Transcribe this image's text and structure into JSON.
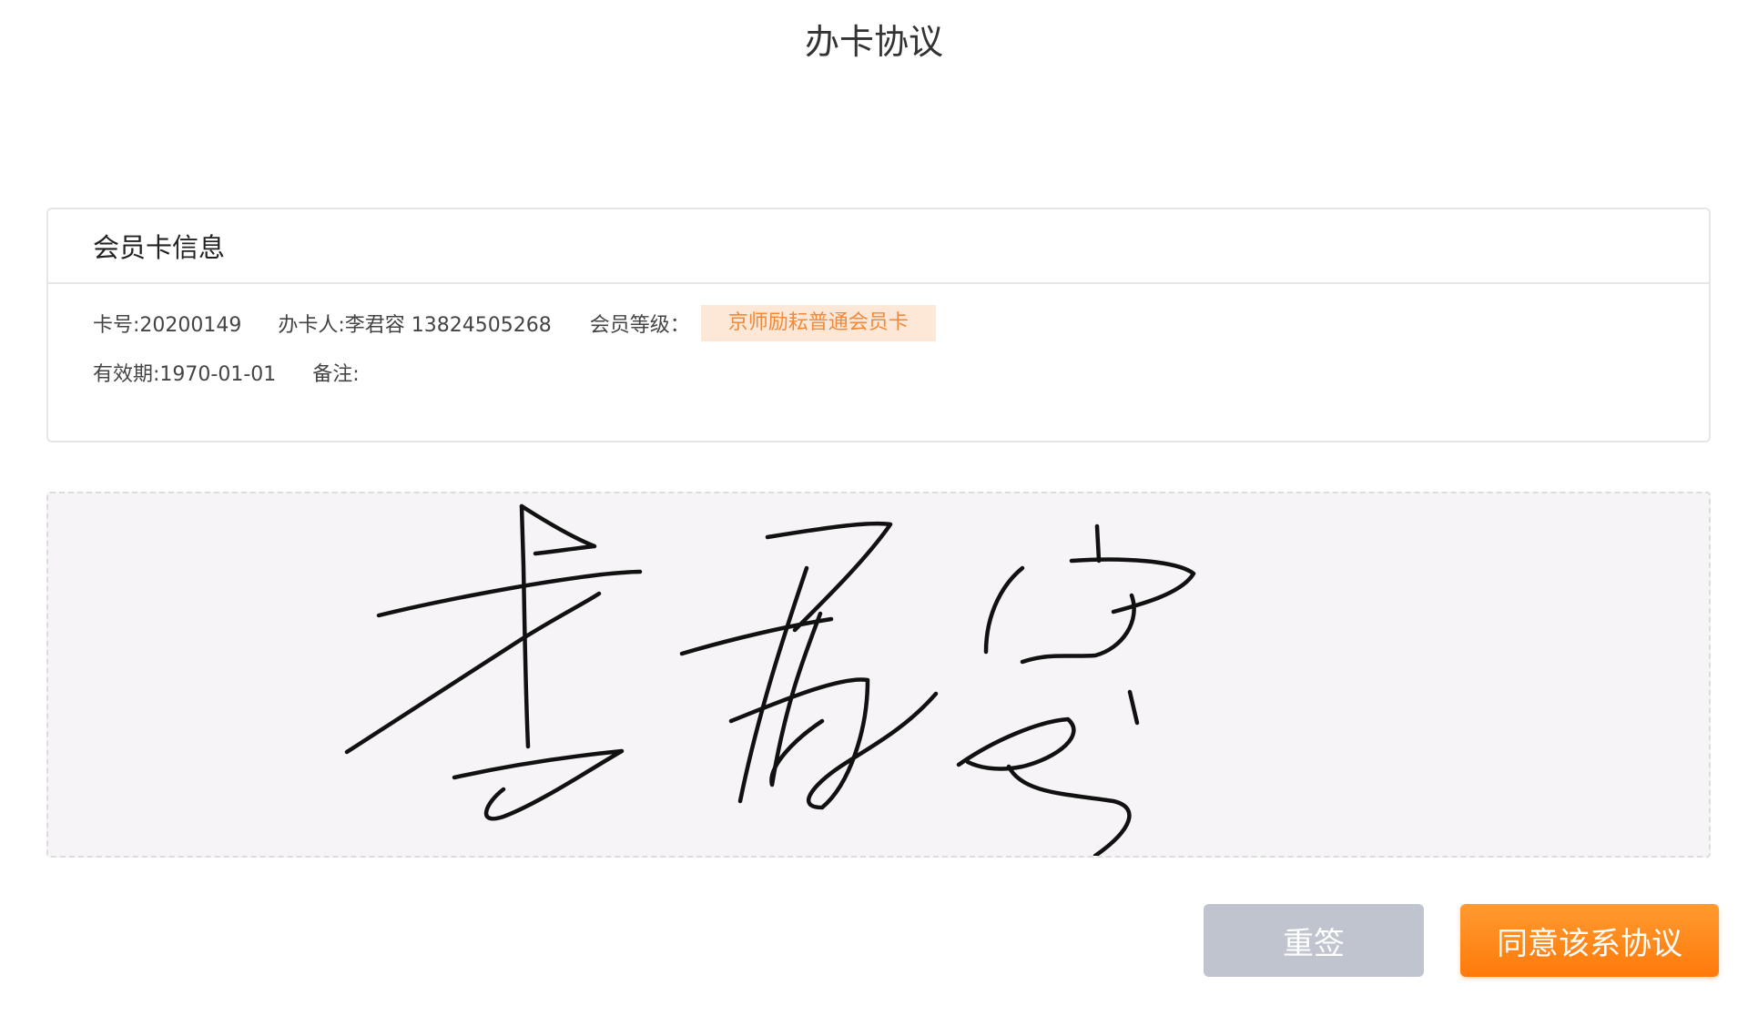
{
  "page": {
    "title": "办卡协议"
  },
  "card_info": {
    "header": "会员卡信息",
    "card_no": "卡号:20200149",
    "applicant": "办卡人:李君容 13824505268",
    "level_label": "会员等级：",
    "level_value": "京师励耘普通会员卡",
    "valid_until": "有效期:1970-01-01",
    "remark": "备注:"
  },
  "signature": {
    "signed": true
  },
  "actions": {
    "resign_label": "重签",
    "agree_label": "同意该系协议"
  },
  "colors": {
    "accent": "#ff8a1e",
    "badge_bg": "#fde8d8",
    "badge_text": "#f08a3a",
    "resign_bg": "#bfc4cf",
    "pad_bg": "#f7f4f7"
  }
}
